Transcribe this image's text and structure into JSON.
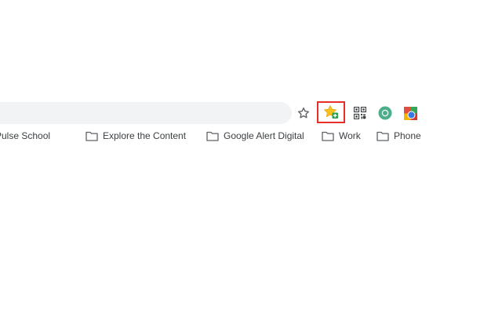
{
  "toolbar": {
    "bookmark_star_icon": "star-outline-icon",
    "highlighted_extension_icon": "bookmark-add-extension-icon",
    "qr_icon": "qr-code-icon",
    "profile_icon": "profile-avatar-icon",
    "extension_icon": "colorful-extension-icon",
    "highlight_color": "#e5302a",
    "omnibox_color": "#f1f3f4"
  },
  "bookmarks_bar": {
    "items": [
      {
        "label": "Pulse School",
        "icon": "none"
      },
      {
        "label": "Explore the Content",
        "icon": "folder-icon"
      },
      {
        "label": "Google Alert Digital",
        "icon": "folder-icon"
      },
      {
        "label": "Work",
        "icon": "folder-icon"
      },
      {
        "label": "Phone",
        "icon": "folder-icon"
      }
    ]
  }
}
